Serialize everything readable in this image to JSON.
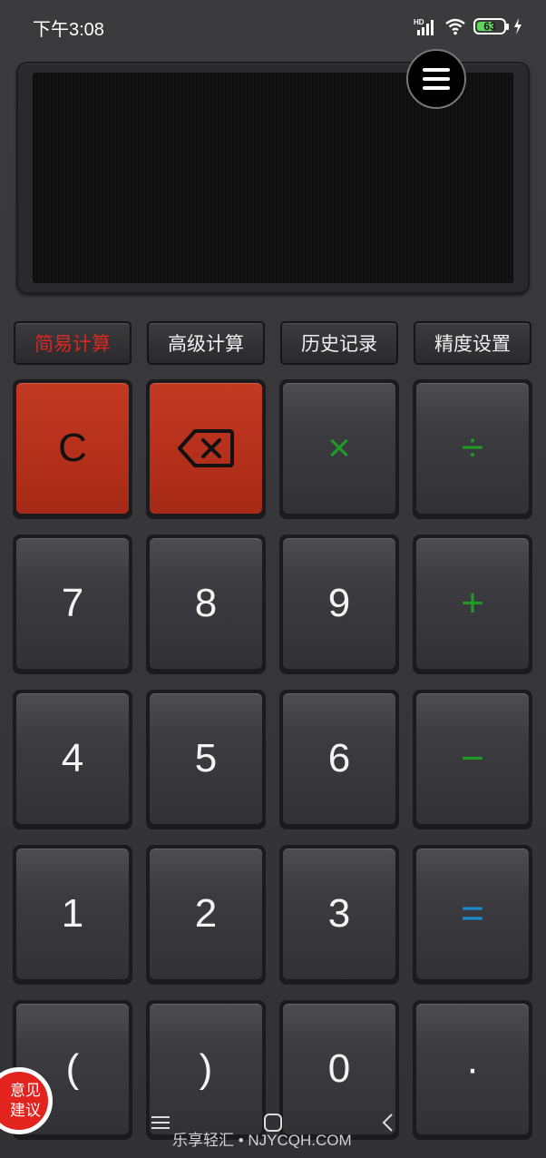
{
  "status_bar": {
    "time": "下午3:08",
    "network": "HD",
    "battery": "63",
    "battery_level": 0.63
  },
  "display": {
    "value": ""
  },
  "menu": {
    "icon": "hamburger-menu-icon"
  },
  "tabs": [
    {
      "label": "简易计算",
      "active": true
    },
    {
      "label": "高级计算",
      "active": false
    },
    {
      "label": "历史记录",
      "active": false
    },
    {
      "label": "精度设置",
      "active": false
    }
  ],
  "keys": {
    "clear": "C",
    "backspace": "backspace-icon",
    "multiply": "×",
    "divide": "÷",
    "seven": "7",
    "eight": "8",
    "nine": "9",
    "plus": "+",
    "four": "4",
    "five": "5",
    "six": "6",
    "minus": "−",
    "one": "1",
    "two": "2",
    "three": "3",
    "equals": "=",
    "paren_open": "(",
    "paren_close": ")",
    "zero": "0",
    "dot": "·"
  },
  "feedback": {
    "line1": "意见",
    "line2": "建议"
  },
  "watermark": "乐享轻汇 • NJYCQH.COM",
  "colors": {
    "accent_red": "#e0251f",
    "operator_green": "#1f9a25",
    "equals_blue": "#1c8bd1",
    "red_key": "#b8311c"
  }
}
